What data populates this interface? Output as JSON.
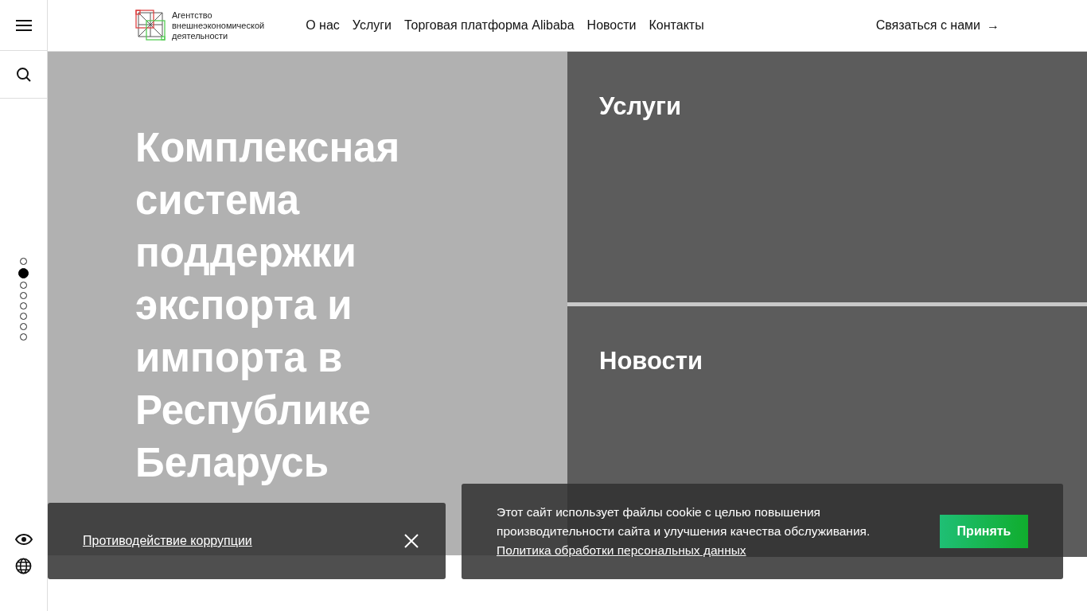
{
  "header": {
    "logo_text": [
      "Агентство",
      "внешнеэкономической",
      "деятельности"
    ],
    "nav": [
      {
        "label": "О нас"
      },
      {
        "label": "Услуги"
      },
      {
        "label": "Торговая платформа Alibaba"
      },
      {
        "label": "Новости"
      },
      {
        "label": "Контакты"
      }
    ],
    "contact_link": "Связаться с нами",
    "contact_arrow": "→"
  },
  "slide_dots": [
    {
      "selected": false
    },
    {
      "selected": true
    },
    {
      "selected": false
    },
    {
      "selected": false
    },
    {
      "selected": false
    },
    {
      "selected": false
    },
    {
      "selected": false
    },
    {
      "selected": false
    }
  ],
  "hero": {
    "title": "Комплексная система поддержки экспорта и импорта в Республике Беларусь"
  },
  "tiles": [
    {
      "title": "Услуги"
    },
    {
      "title": "Новости"
    }
  ],
  "anticorruption_bar": {
    "link": "Противодействие коррупции"
  },
  "cookie_banner": {
    "text": "Этот сайт использует файлы cookie с целью повышения производительности сайта и улучшения качества обслуживания.",
    "link": "Политика обработки персональных данных",
    "button": "Принять"
  }
}
